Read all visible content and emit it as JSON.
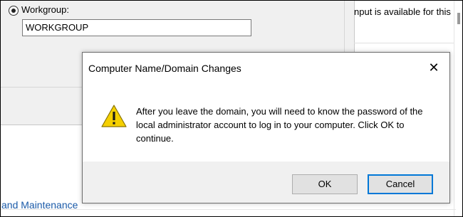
{
  "background": {
    "workgroup_label": "Workgroup:",
    "workgroup_value": "WORKGROUP",
    "right_text": "nput is available for this",
    "link_text": "and Maintenance"
  },
  "dialog": {
    "title": "Computer Name/Domain Changes",
    "close_glyph": "✕",
    "message": "After you leave the domain, you will need to know the password of the local administrator account to log in to your computer. Click OK to continue.",
    "ok_label": "OK",
    "cancel_label": "Cancel",
    "icon": "warning-icon"
  },
  "colors": {
    "accent": "#0078d7",
    "warning": "#f5d000",
    "link": "#1a5aa8"
  }
}
